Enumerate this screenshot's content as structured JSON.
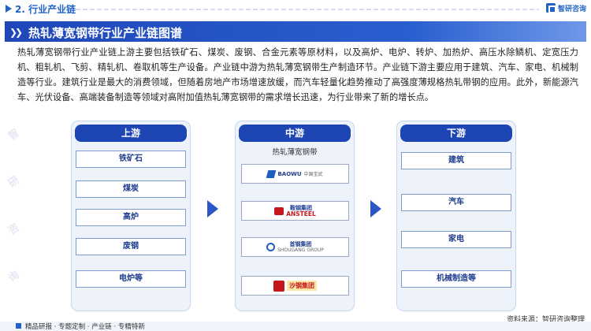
{
  "header": {
    "section_title": "2. 行业产业链",
    "logo_name": "智研咨询"
  },
  "banner": {
    "title": "热轧薄宽钢带行业产业链图谱"
  },
  "paragraph": "热轧薄宽钢带行业产业链上游主要包括铁矿石、煤炭、废钢、合金元素等原材料，以及高炉、电炉、转炉、加热炉、高压水除鳞机、定宽压力机、粗轧机、飞剪、精轧机、卷取机等生产设备。产业链中游为热轧薄宽钢带生产制造环节。产业链下游主要应用于建筑、汽车、家电、机械制造等行业。建筑行业是最大的消费领域，但随着房地产市场增速放缓，而汽车轻量化趋势推动了高强度薄规格热轧带钢的应用。此外，新能源汽车、光伏设备、高端装备制造等领域对高附加值热轧薄宽钢带的需求增长迅速，为行业带来了新的增长点。",
  "upstream": {
    "title": "上游",
    "items": [
      "铁矿石",
      "煤炭",
      "高炉",
      "废钢",
      "电炉等"
    ]
  },
  "midstream": {
    "title": "中游",
    "subtitle": "热轧薄宽钢带",
    "logos": [
      {
        "name": "BAOWU",
        "sub": "中国宝武"
      },
      {
        "name": "鞍钢集团",
        "sub": "ANSTEEL"
      },
      {
        "name": "首钢集团",
        "sub": "SHOUGANG GROUP"
      },
      {
        "name": "沙钢集团",
        "sub": ""
      }
    ]
  },
  "downstream": {
    "title": "下游",
    "items": [
      "建筑",
      "汽车",
      "家电",
      "机械制造等"
    ]
  },
  "watermark": [
    "智",
    "研",
    "咨",
    "询"
  ],
  "footer": {
    "tags": "精品研报 · 专题定制 · 产业链 · 专精特新",
    "source": "资料来源：智研咨询整理"
  },
  "colors": {
    "primary": "#1f47b8",
    "accent": "#1f63c6",
    "panel": "#eef3fb"
  }
}
